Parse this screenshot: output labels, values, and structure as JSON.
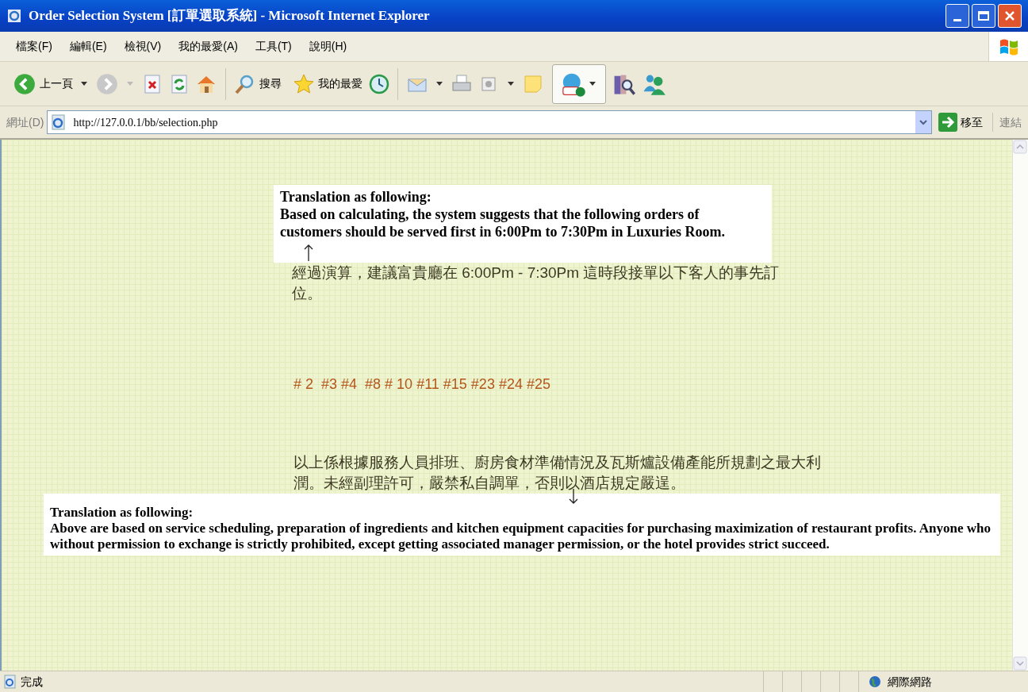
{
  "window": {
    "title": "Order Selection System [訂單選取系統] - Microsoft Internet Explorer"
  },
  "menu": [
    "檔案(F)",
    "編輯(E)",
    "檢視(V)",
    "我的最愛(A)",
    "工具(T)",
    "說明(H)"
  ],
  "toolbar": {
    "back": "上一頁",
    "search": "搜尋",
    "favorites": "我的最愛"
  },
  "address_bar": {
    "label": "網址(D)",
    "url": "http://127.0.0.1/bb/selection.php",
    "go": "移至",
    "links": "連結"
  },
  "page": {
    "top_translation": {
      "heading": "Translation as following:",
      "body": "Based on calculating, the system suggests that the following orders of customers should be served first in 6:00Pm to 7:30Pm in Luxuries Room."
    },
    "notice": "經過演算，建議富貴廳在 6:00Pm - 7:30Pm 這時段接單以下客人的事先訂位。",
    "orders": "# 2  #3 #4  #8 # 10 #11 #15 #23 #24 #25",
    "policy": "以上係根據服務人員排班、廚房食材準備情況及瓦斯爐設備產能所規劃之最大利潤。未經副理許可，嚴禁私自調單，否則以酒店規定嚴逞。",
    "bottom_translation": {
      "heading": "Translation as following:",
      "body": "Above are based on service scheduling, preparation of ingredients and kitchen equipment capacities for purchasing maximization of restaurant profits. Anyone who without permission to exchange is strictly prohibited, except getting associated manager permission, or the hotel provides strict succeed."
    }
  },
  "status_bar": {
    "status": "完成",
    "zone": "網際網路"
  }
}
